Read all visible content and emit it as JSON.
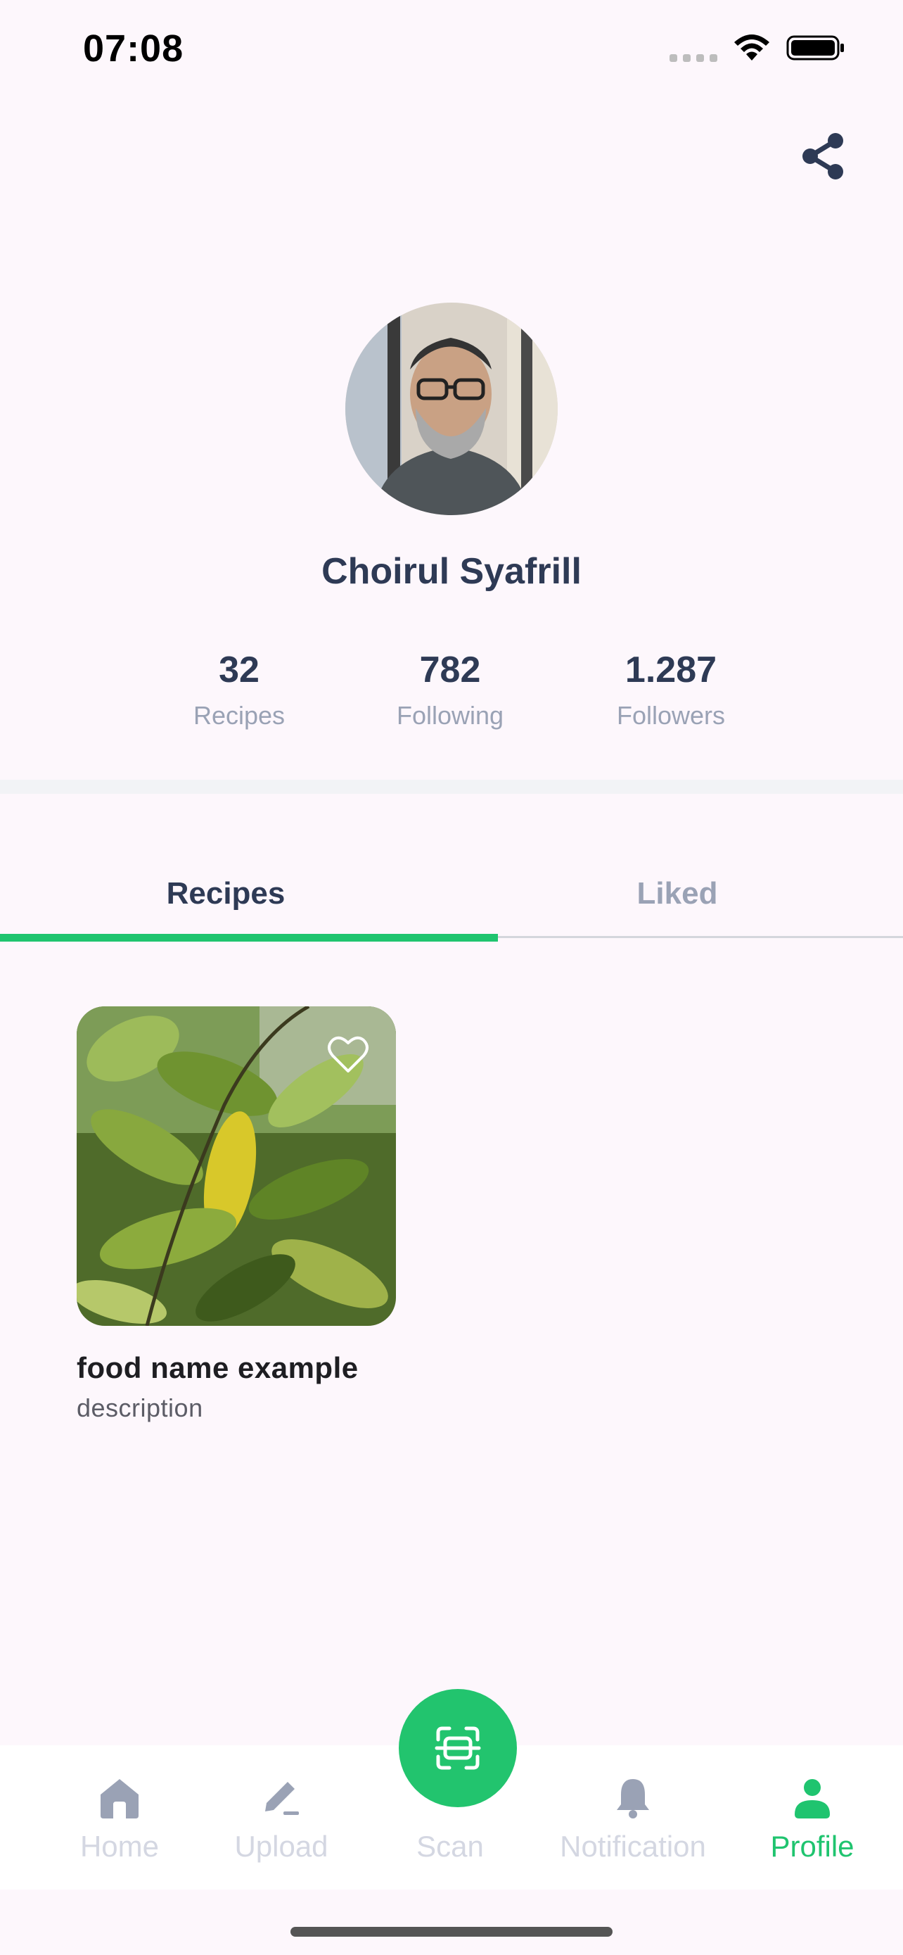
{
  "status_bar": {
    "time": "07:08"
  },
  "profile": {
    "name": "Choirul Syafrill",
    "stats": [
      {
        "value": "32",
        "label": "Recipes"
      },
      {
        "value": "782",
        "label": "Following"
      },
      {
        "value": "1.287",
        "label": "Followers"
      }
    ]
  },
  "tabs": [
    {
      "label": "Recipes",
      "active": true
    },
    {
      "label": "Liked",
      "active": false
    }
  ],
  "recipes": [
    {
      "title": "food name example",
      "description": "description"
    }
  ],
  "bottom_nav": [
    {
      "label": "Home",
      "icon": "home-icon"
    },
    {
      "label": "Upload",
      "icon": "pencil-icon"
    },
    {
      "label": "Scan",
      "icon": "scan-icon"
    },
    {
      "label": "Notification",
      "icon": "bell-icon"
    },
    {
      "label": "Profile",
      "icon": "person-icon",
      "active": true
    }
  ],
  "colors": {
    "accent": "#1fc46f",
    "text_primary": "#2e3a55",
    "text_muted": "#9aa2b5",
    "background": "#fdf7fc"
  }
}
